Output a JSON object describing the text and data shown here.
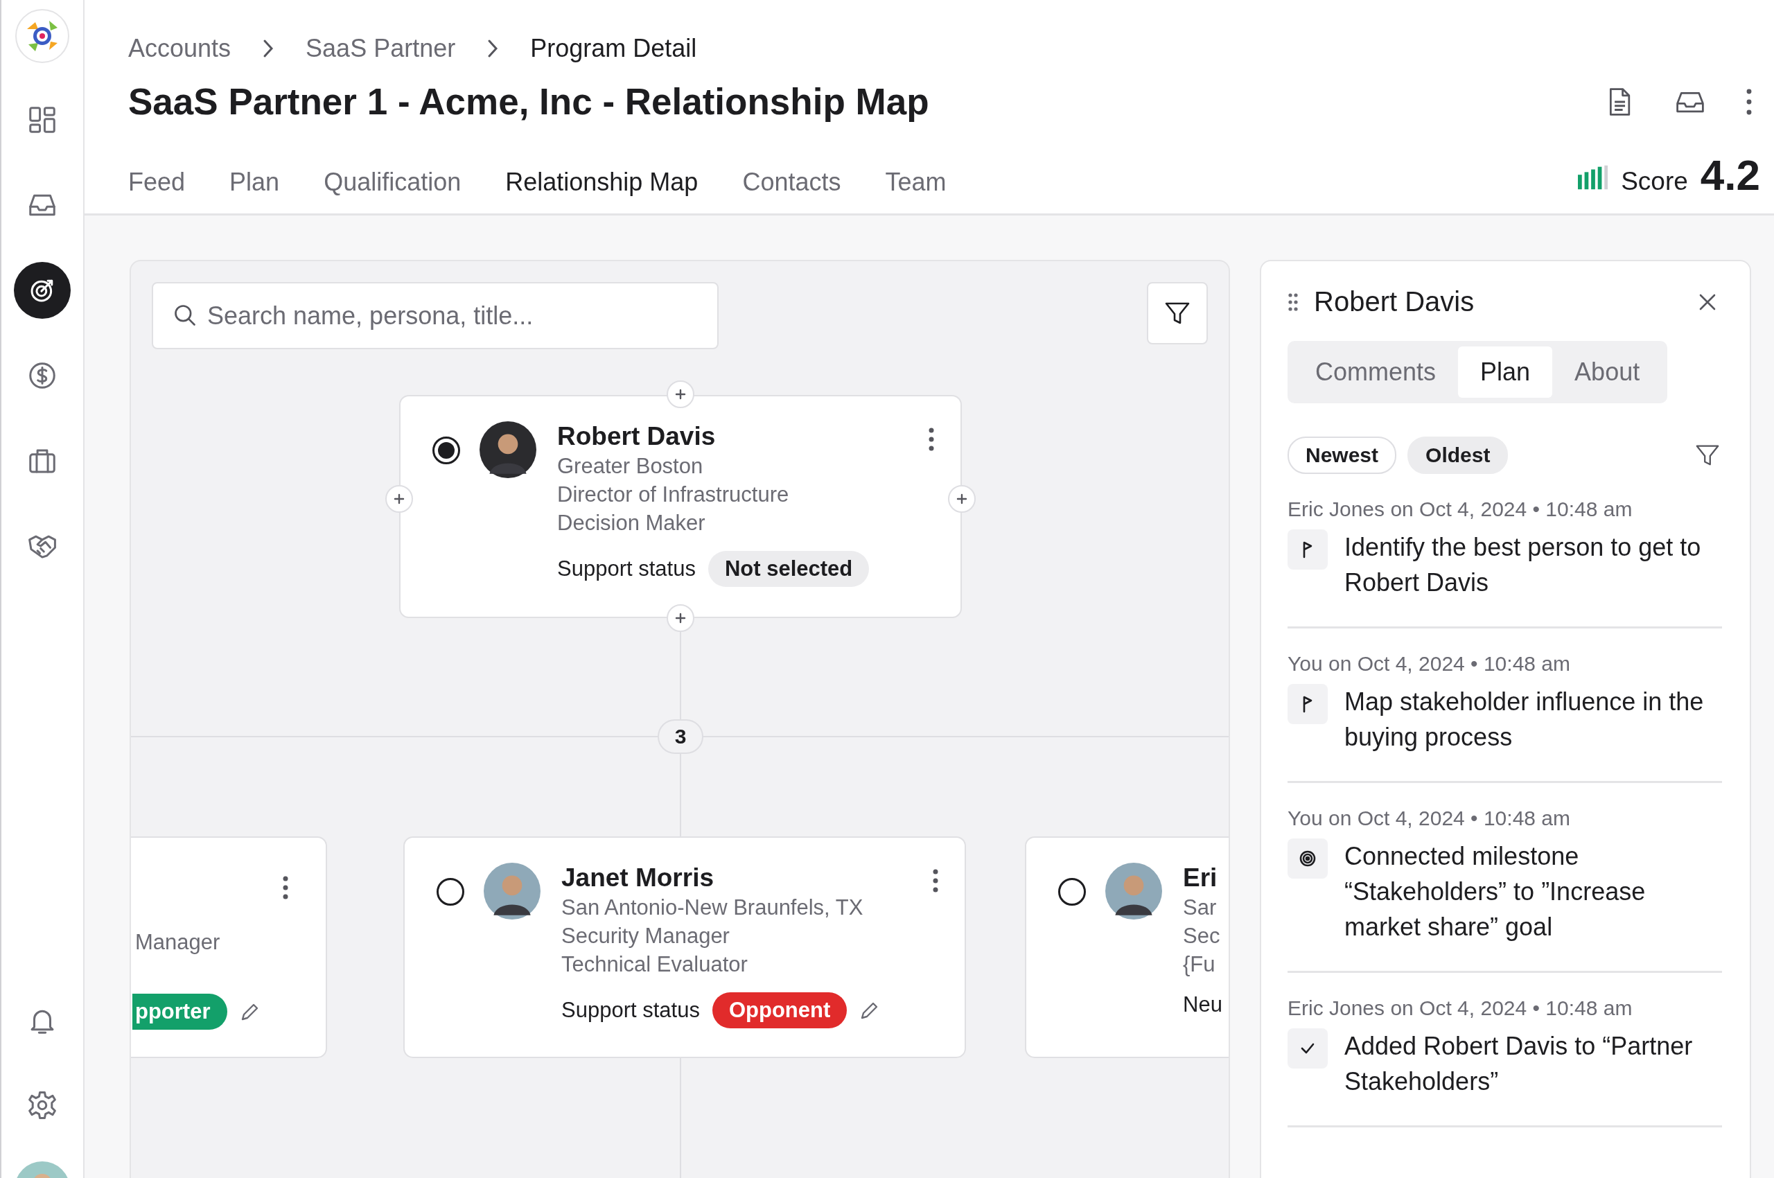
{
  "sidebar": {
    "items": [
      {
        "kind": "dashboard",
        "selected": false
      },
      {
        "kind": "inbox",
        "selected": false
      },
      {
        "kind": "target",
        "selected": true
      },
      {
        "kind": "dollar",
        "selected": false
      },
      {
        "kind": "briefcase",
        "selected": false
      },
      {
        "kind": "handshake",
        "selected": false
      }
    ],
    "bottom_items": [
      {
        "kind": "bell"
      },
      {
        "kind": "settings"
      },
      {
        "kind": "user"
      }
    ]
  },
  "breadcrumb": [
    {
      "label": "Accounts",
      "current": false
    },
    {
      "label": "SaaS Partner",
      "current": false
    },
    {
      "label": "Program Detail",
      "current": true
    }
  ],
  "title": "SaaS Partner 1 - Acme, Inc - Relationship Map",
  "tabs": [
    {
      "label": "Feed",
      "selected": false
    },
    {
      "label": "Plan",
      "selected": false
    },
    {
      "label": "Qualification",
      "selected": false
    },
    {
      "label": "Relationship Map",
      "selected": true
    },
    {
      "label": "Contacts",
      "selected": false
    },
    {
      "label": "Team",
      "selected": false
    }
  ],
  "score": {
    "label": "Score",
    "value": "4.2"
  },
  "map": {
    "search": {
      "placeholder": "Search name, persona, title..."
    },
    "root": {
      "kind": "full",
      "selected": true,
      "name": "Robert Davis",
      "lines": [
        "Greater Boston",
        "Director of Infrastructure",
        "Decision Maker"
      ],
      "status_label": "Support status",
      "status": {
        "label": "Not selected",
        "color": "#ececee"
      },
      "editable": false
    },
    "group_count": "3",
    "children": [
      {
        "kind": "left-partial",
        "lines": [
          "Manager"
        ],
        "status": {
          "label": "pporter",
          "color": "#13a06a"
        },
        "editable": true
      },
      {
        "kind": "full",
        "selected": false,
        "name": "Janet Morris",
        "lines": [
          "San Antonio-New Braunfels, TX",
          "Security Manager",
          "Technical Evaluator"
        ],
        "status_label": "Support status",
        "status": {
          "label": "Opponent",
          "color": "#e12b2b"
        },
        "editable": true
      },
      {
        "kind": "right-partial",
        "selected": false,
        "name": "Eri",
        "lines": [
          "Sar",
          "Sec",
          "{Fu"
        ],
        "status_label": "Neu"
      }
    ]
  },
  "panel": {
    "title": "Robert Davis",
    "tabs": [
      {
        "label": "Comments",
        "selected": false
      },
      {
        "label": "Plan",
        "selected": true
      },
      {
        "label": "About",
        "selected": false
      }
    ],
    "sort": [
      {
        "label": "Newest",
        "selected": true
      },
      {
        "label": "Oldest",
        "selected": false
      }
    ],
    "items": [
      {
        "meta": "Eric Jones on Oct 4, 2024 • 10:48 am",
        "kind": "flag",
        "text": "Identify the best person to get to Robert Davis"
      },
      {
        "meta": "You on Oct 4, 2024 • 10:48 am",
        "kind": "flag",
        "text": "Map stakeholder influence in the buying process"
      },
      {
        "meta": "You on Oct 4, 2024 • 10:48 am",
        "kind": "target",
        "text": "Connected milestone “Stakeholders” to ”Increase market share” goal"
      },
      {
        "meta": "Eric Jones on Oct 4, 2024 • 10:48 am",
        "kind": "check",
        "text": "Added Robert Davis to  “Partner Stakeholders”"
      }
    ]
  }
}
